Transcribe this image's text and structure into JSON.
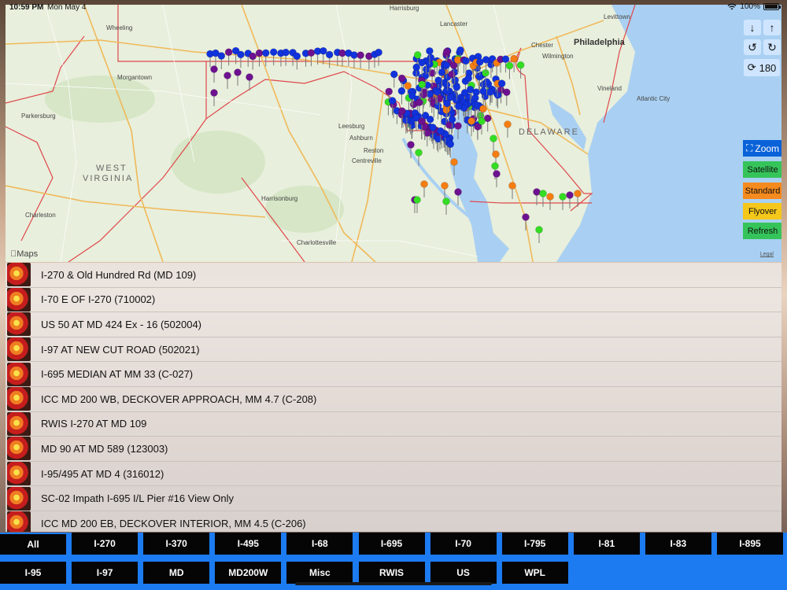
{
  "status": {
    "time": "10:59 PM",
    "date": "Mon May 4",
    "battery": "100%"
  },
  "map": {
    "logo": "Maps",
    "legal": "Legal",
    "rotation": "180",
    "labels": [
      {
        "key": "philadelphia",
        "text": "Philadelphia"
      },
      {
        "key": "delaware",
        "text": "DELAWARE"
      },
      {
        "key": "west",
        "text": "WEST"
      },
      {
        "key": "virginia",
        "text": "VIRGINIA"
      },
      {
        "key": "wheeling",
        "text": "Wheeling"
      },
      {
        "key": "morgantown",
        "text": "Morgantown"
      },
      {
        "key": "parkersburg",
        "text": "Parkersburg"
      },
      {
        "key": "charleston",
        "text": "Charleston"
      },
      {
        "key": "harrisonburg",
        "text": "Harrisonburg"
      },
      {
        "key": "charlottesville",
        "text": "Charlottesville"
      },
      {
        "key": "leesburg",
        "text": "Leesburg"
      },
      {
        "key": "ashburn",
        "text": "Ashburn"
      },
      {
        "key": "reston",
        "text": "Reston"
      },
      {
        "key": "centreville",
        "text": "Centreville"
      },
      {
        "key": "chester",
        "text": "Chester"
      },
      {
        "key": "wilmington",
        "text": "Wilmington"
      },
      {
        "key": "vineland",
        "text": "Vineland"
      },
      {
        "key": "atlantic",
        "text": "Atlantic City"
      },
      {
        "key": "lancaster",
        "text": "Lancaster"
      },
      {
        "key": "harrisburg",
        "text": "Harrisburg"
      },
      {
        "key": "levittown",
        "text": "Levittown"
      }
    ],
    "buttons": {
      "zoom": "Zoom",
      "satellite": "Satellite",
      "standard": "Standard",
      "flyover": "Flyover",
      "refresh": "Refresh"
    },
    "colors": {
      "zoom": "#0a62d8",
      "satellite": "#35c45a",
      "standard": "#f58a1e",
      "flyover": "#f4c71a",
      "refresh": "#35c45a"
    }
  },
  "cameras": [
    "I-270 & Old Hundred Rd (MD 109)",
    "I-70 E OF I-270 (710002)",
    "US 50 AT MD 424 Ex - 16 (502004)",
    "I-97 AT NEW CUT ROAD (502021)",
    "I-695 MEDIAN AT MM 33 (C-027)",
    "ICC MD 200 WB, DECKOVER APPROACH, MM 4.7 (C-208)",
    "RWIS I-270 AT MD 109",
    "MD 90 AT MD 589 (123003)",
    "I-95/495 AT MD 4 (316012)",
    "SC-02 Impath I-695 I/L Pier #16 View Only",
    "ICC MD 200 EB, DECKOVER INTERIOR, MM 4.5 (C-206)"
  ],
  "tabs": {
    "row1": [
      "All",
      "I-270",
      "I-370",
      "I-495",
      "I-68",
      "I-695",
      "I-70",
      "I-795",
      "I-81",
      "I-83",
      "I-895"
    ],
    "row2": [
      "I-95",
      "I-97",
      "MD",
      "MD200W",
      "Misc",
      "RWIS",
      "US",
      "WPL"
    ]
  },
  "pin_colors": {
    "blue": "#1133dd",
    "purple": "#6e1190",
    "orange": "#f57d12",
    "green": "#33dd22"
  }
}
